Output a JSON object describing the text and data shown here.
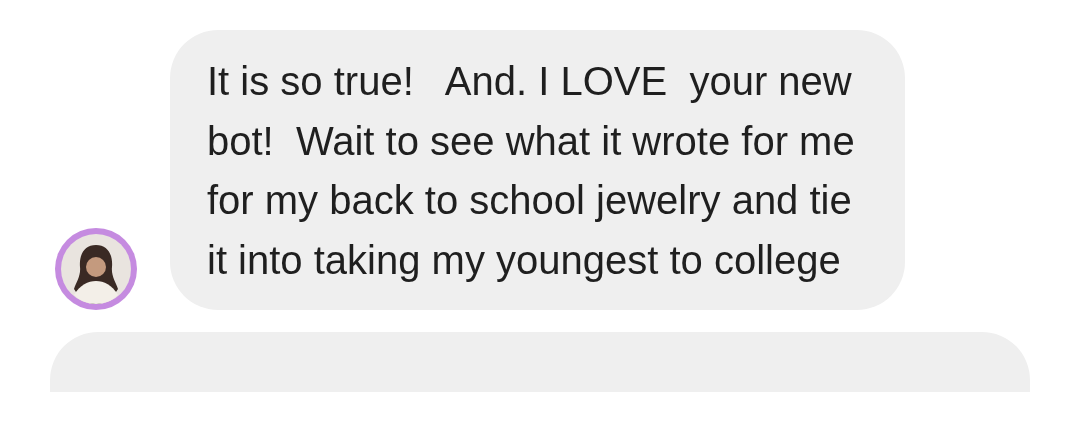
{
  "messages": [
    {
      "kind": "text",
      "text": "It is so true!   And. I LOVE  your new bot!  Wait to see what it wrote for me for my back to school jewelry and tie it into taking my youngest to college"
    },
    {
      "kind": "partial"
    }
  ]
}
